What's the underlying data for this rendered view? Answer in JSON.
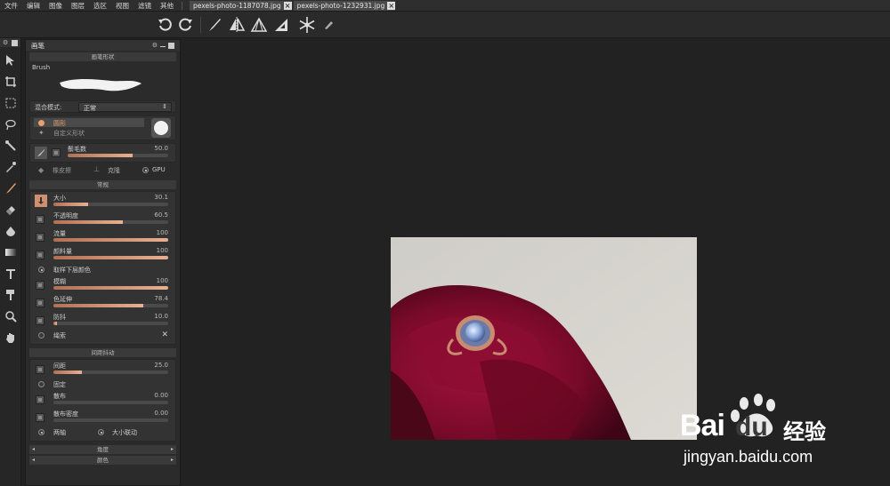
{
  "menubar": {
    "items": [
      "文件",
      "编辑",
      "图像",
      "图层",
      "选区",
      "视图",
      "滤镜",
      "其他"
    ],
    "tabs": [
      {
        "label": "pexels-photo-1187078.jpg"
      },
      {
        "label": "pexels-photo-1232931.jpg"
      }
    ]
  },
  "toolbar": {
    "buttons": [
      "undo-icon",
      "redo-icon",
      "brush-icon",
      "mirror-symmetry-icon",
      "perspective-icon",
      "ruler-triangle-icon",
      "snowflake-icon",
      "pen-icon"
    ]
  },
  "toolstrip": {
    "tools": [
      "move-icon",
      "crop-icon",
      "marquee-icon",
      "lasso-icon",
      "magic-wand-icon",
      "eyedropper-icon",
      "brush-tool-icon",
      "eraser-icon",
      "fill-icon",
      "gradient-icon",
      "text-icon",
      "smudge-icon",
      "zoom-icon",
      "hand-icon"
    ]
  },
  "panel": {
    "title": "画笔",
    "brush_shape_section": "画笔形状",
    "brush_name": "Brush",
    "blend_label": "混合模式:",
    "blend_value": "正常",
    "shape_round": "圆形",
    "shape_custom": "自定义形状",
    "bristles_label": "鬃毛数",
    "bristles_value": "50.0",
    "eraser_label": "橡皮擦",
    "clone_label": "克隆",
    "gpu_label": "GPU",
    "general_section": "常规",
    "sliders_general": [
      {
        "label": "大小",
        "value": "30.1",
        "fill": 0.3
      },
      {
        "label": "不透明度",
        "value": "60.5",
        "fill": 0.605
      },
      {
        "label": "流量",
        "value": "100",
        "fill": 1.0
      },
      {
        "label": "颜料量",
        "value": "100",
        "fill": 1.0
      }
    ],
    "sample_below": "取样下层颜色",
    "sliders_general2": [
      {
        "label": "模糊",
        "value": "100",
        "fill": 1.0
      },
      {
        "label": "色延伸",
        "value": "78.4",
        "fill": 0.784
      },
      {
        "label": "防抖",
        "value": "10.0",
        "fill": 0.03
      }
    ],
    "rope_label": "绳索",
    "jitter_section": "间距抖动",
    "spacing": {
      "label": "间距",
      "value": "25.0",
      "fill": 0.25
    },
    "fixed_label": "固定",
    "scatter": {
      "label": "散布",
      "value": "0.00",
      "fill": 0.0
    },
    "scatter_density": {
      "label": "散布密度",
      "value": "0.00",
      "fill": 0.0
    },
    "both_axes": "两轴",
    "size_link": "大小联动",
    "angle_section": "角度",
    "color_section": "颜色"
  },
  "watermark": {
    "brand_prefix": "Bai",
    "brand_suffix": "经验",
    "url": "jingyan.baidu.com"
  },
  "colors": {
    "accent": "#e8a070",
    "slider_fill": "#d09070",
    "canvas_bg": "#222222"
  }
}
